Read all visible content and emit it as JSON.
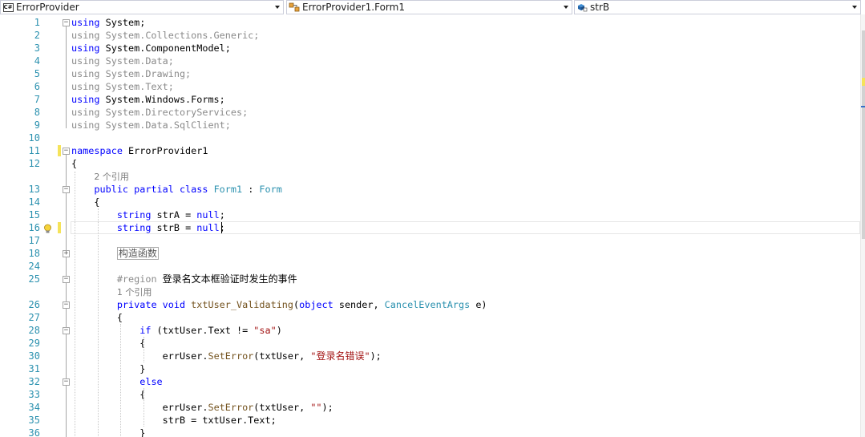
{
  "navbar": {
    "project": {
      "label": "ErrorProvider",
      "icon": "csharp-project-icon"
    },
    "type": {
      "label": "ErrorProvider1.Form1",
      "icon": "class-icon"
    },
    "member": {
      "label": "strB",
      "icon": "field-icon"
    }
  },
  "editor": {
    "lines": [
      {
        "n": "1",
        "html": "<span class=\"kw\">using</span> System;"
      },
      {
        "n": "2",
        "html": "<span class=\"dim\">using System.Collections.Generic;</span>"
      },
      {
        "n": "3",
        "html": "<span class=\"kw\">using</span> System.ComponentModel;"
      },
      {
        "n": "4",
        "html": "<span class=\"dim\">using System.Data;</span>"
      },
      {
        "n": "5",
        "html": "<span class=\"dim\">using System.Drawing;</span>"
      },
      {
        "n": "6",
        "html": "<span class=\"dim\">using System.Text;</span>"
      },
      {
        "n": "7",
        "html": "<span class=\"kw\">using</span> System.Windows.Forms;"
      },
      {
        "n": "8",
        "html": "<span class=\"dim\">using System.DirectoryServices;</span>"
      },
      {
        "n": "9",
        "html": "<span class=\"dim\">using System.Data.SqlClient;</span>"
      },
      {
        "n": "10",
        "html": ""
      },
      {
        "n": "11",
        "html": "<span class=\"kw\">namespace</span> ErrorProvider1"
      },
      {
        "n": "12",
        "html": "{"
      },
      {
        "n": "",
        "html": "    <span class=\"ref\">2 个引用</span>"
      },
      {
        "n": "13",
        "html": "    <span class=\"kw\">public partial class</span> <span class=\"ty\">Form1</span> : <span class=\"ty\">Form</span>"
      },
      {
        "n": "14",
        "html": "    {"
      },
      {
        "n": "15",
        "html": "        <span class=\"kw\">string</span> strA = <span class=\"kw\">null</span>;"
      },
      {
        "n": "16",
        "html": "        <span class=\"kw\">string</span> strB = <span class=\"kw\">null</span>;"
      },
      {
        "n": "17",
        "html": ""
      },
      {
        "n": "18",
        "html": "        <span class=\"collapsed\">构造函数</span>"
      },
      {
        "n": "24",
        "html": ""
      },
      {
        "n": "25",
        "html": "        <span class=\"dim\">#region</span> <span class=\"cjk\">登录名文本框验证时发生的事件</span>"
      },
      {
        "n": "",
        "html": "        <span class=\"ref\">1 个引用</span>"
      },
      {
        "n": "26",
        "html": "        <span class=\"kw\">private void</span> <span class=\"mt\">txtUser_Validating</span>(<span class=\"kw\">object</span> sender, <span class=\"ty\">CancelEventArgs</span> e)"
      },
      {
        "n": "27",
        "html": "        {"
      },
      {
        "n": "28",
        "html": "            <span class=\"kw\">if</span> (txtUser.Text != <span class=\"str\">\"sa\"</span>)"
      },
      {
        "n": "29",
        "html": "            {"
      },
      {
        "n": "30",
        "html": "                errUser.<span class=\"mt\">SetError</span>(txtUser, <span class=\"str\">\"<span class=\"cjk\">登录名错误</span>\"</span>);"
      },
      {
        "n": "31",
        "html": "            }"
      },
      {
        "n": "32",
        "html": "            <span class=\"kw\">else</span>"
      },
      {
        "n": "33",
        "html": "            {"
      },
      {
        "n": "34",
        "html": "                errUser.<span class=\"mt\">SetError</span>(txtUser, <span class=\"str\">\"\"</span>);"
      },
      {
        "n": "35",
        "html": "                strB = txtUser.Text;"
      },
      {
        "n": "36",
        "html": "            }"
      }
    ]
  }
}
